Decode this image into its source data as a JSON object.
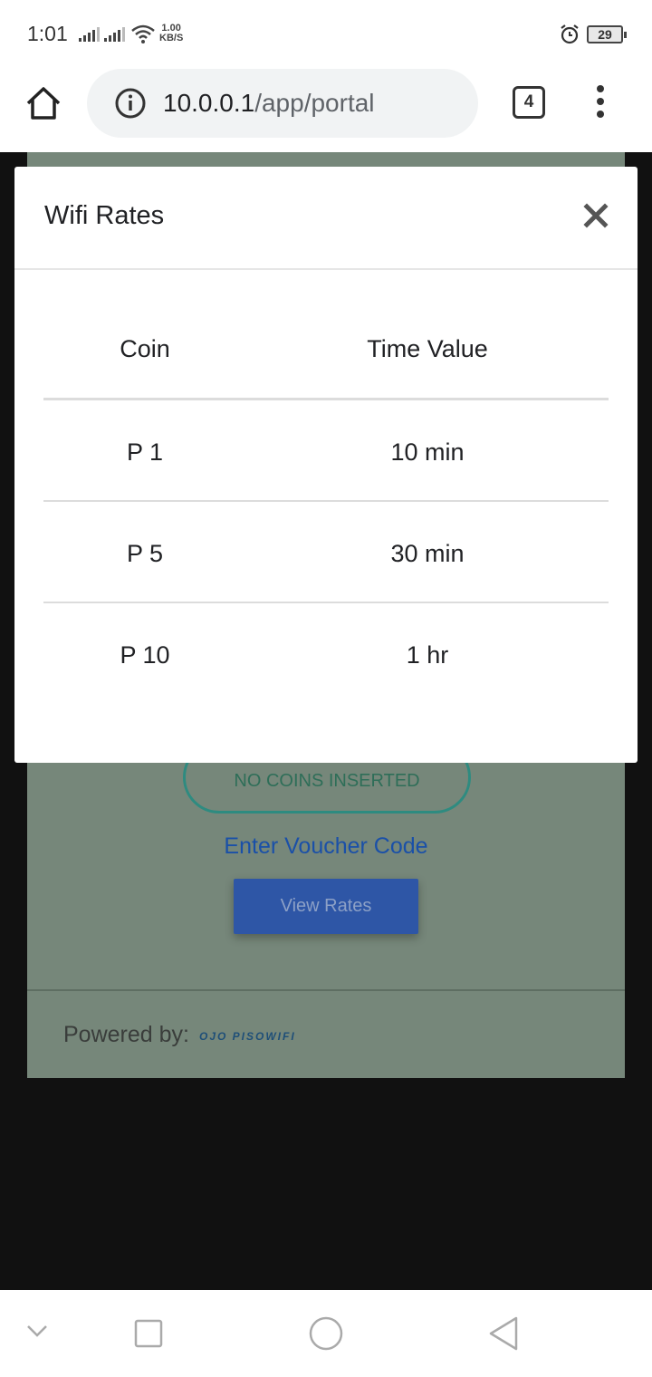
{
  "status_bar": {
    "time": "1:01",
    "net_speed_value": "1.00",
    "net_speed_unit": "KB/S",
    "battery": "29"
  },
  "browser": {
    "url_host": "10.0.0.1",
    "url_path": "/app/portal",
    "tab_count": "4"
  },
  "page": {
    "coins_status": "NO COINS INSERTED",
    "voucher_link": "Enter Voucher Code",
    "view_rates_button": "View Rates",
    "powered_by_label": "Powered by:",
    "powered_by_brand": "OJO PISOWIFI"
  },
  "modal": {
    "title": "Wifi Rates",
    "columns": [
      "Coin",
      "Time Value"
    ],
    "rows": [
      {
        "coin": "P 1",
        "time": "10 min"
      },
      {
        "coin": "P 5",
        "time": "30 min"
      },
      {
        "coin": "P 10",
        "time": "1 hr"
      }
    ]
  },
  "icons": {
    "home": "home-icon",
    "info": "info-icon",
    "menu": "more-vert-icon",
    "close": "close-icon",
    "wifi": "wifi-icon",
    "alarm": "alarm-icon"
  }
}
